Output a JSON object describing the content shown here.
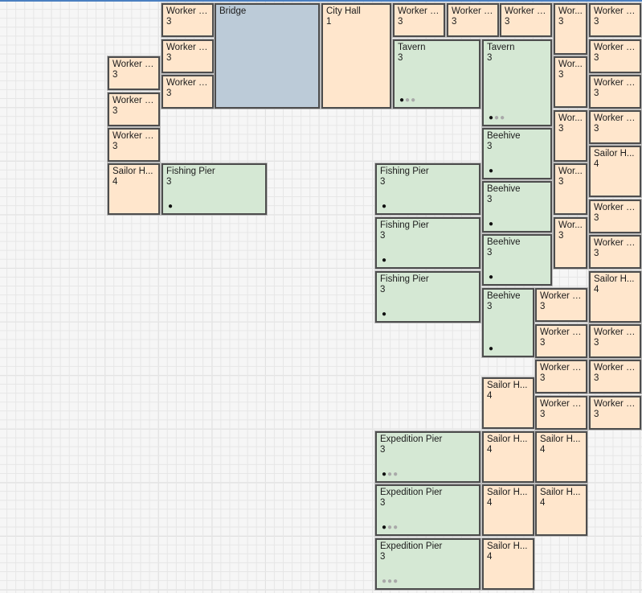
{
  "tiles": [
    {
      "name": "Worker H...",
      "level": "3",
      "kind": "worker"
    },
    {
      "name": "Bridge",
      "level": "",
      "kind": "road"
    },
    {
      "name": "City Hall",
      "level": "1",
      "kind": "civic"
    },
    {
      "name": "Worker H...",
      "level": "3",
      "kind": "worker"
    },
    {
      "name": "Worker H...",
      "level": "3",
      "kind": "worker"
    },
    {
      "name": "Worker H...",
      "level": "3",
      "kind": "worker"
    },
    {
      "name": "Wor...",
      "level": "3",
      "kind": "worker"
    },
    {
      "name": "Worker H...",
      "level": "3",
      "kind": "worker"
    },
    {
      "name": "Worker H...",
      "level": "3",
      "kind": "worker"
    },
    {
      "name": "Worker H...",
      "level": "3",
      "kind": "worker"
    },
    {
      "name": "Tavern",
      "level": "3",
      "kind": "prod",
      "dots": [
        1,
        0,
        0
      ]
    },
    {
      "name": "Tavern",
      "level": "3",
      "kind": "prod",
      "dots": [
        1,
        0,
        0
      ]
    },
    {
      "name": "Wor...",
      "level": "3",
      "kind": "worker"
    },
    {
      "name": "Worker H...",
      "level": "3",
      "kind": "worker"
    },
    {
      "name": "Worker H...",
      "level": "3",
      "kind": "worker"
    },
    {
      "name": "Worker H...",
      "level": "3",
      "kind": "worker"
    },
    {
      "name": "Worker H...",
      "level": "3",
      "kind": "worker"
    },
    {
      "name": "Wor...",
      "level": "3",
      "kind": "worker"
    },
    {
      "name": "Worker H...",
      "level": "3",
      "kind": "worker"
    },
    {
      "name": "Worker H...",
      "level": "3",
      "kind": "worker"
    },
    {
      "name": "Beehive",
      "level": "3",
      "kind": "prod",
      "dots": [
        1
      ]
    },
    {
      "name": "Sailor H...",
      "level": "4",
      "kind": "worker"
    },
    {
      "name": "Sailor H...",
      "level": "4",
      "kind": "worker"
    },
    {
      "name": "Fishing Pier",
      "level": "3",
      "kind": "prod",
      "dots": [
        1
      ]
    },
    {
      "name": "Fishing Pier",
      "level": "3",
      "kind": "prod",
      "dots": [
        1
      ]
    },
    {
      "name": "Wor...",
      "level": "3",
      "kind": "worker"
    },
    {
      "name": "Beehive",
      "level": "3",
      "kind": "prod",
      "dots": [
        1
      ]
    },
    {
      "name": "Worker H...",
      "level": "3",
      "kind": "worker"
    },
    {
      "name": "Fishing Pier",
      "level": "3",
      "kind": "prod",
      "dots": [
        1
      ]
    },
    {
      "name": "Wor...",
      "level": "3",
      "kind": "worker"
    },
    {
      "name": "Beehive",
      "level": "3",
      "kind": "prod",
      "dots": [
        1
      ]
    },
    {
      "name": "Worker H...",
      "level": "3",
      "kind": "worker"
    },
    {
      "name": "Fishing Pier",
      "level": "3",
      "kind": "prod",
      "dots": [
        1
      ]
    },
    {
      "name": "Sailor H...",
      "level": "4",
      "kind": "worker"
    },
    {
      "name": "Beehive",
      "level": "3",
      "kind": "prod",
      "dots": [
        1
      ]
    },
    {
      "name": "Worker H...",
      "level": "3",
      "kind": "worker"
    },
    {
      "name": "Worker H...",
      "level": "3",
      "kind": "worker"
    },
    {
      "name": "Worker H...",
      "level": "3",
      "kind": "worker"
    },
    {
      "name": "Worker H...",
      "level": "3",
      "kind": "worker"
    },
    {
      "name": "Worker H...",
      "level": "3",
      "kind": "worker"
    },
    {
      "name": "Sailor H...",
      "level": "4",
      "kind": "worker"
    },
    {
      "name": "Worker H...",
      "level": "3",
      "kind": "worker"
    },
    {
      "name": "Worker H...",
      "level": "3",
      "kind": "worker"
    },
    {
      "name": "Expedition Pier",
      "level": "3",
      "kind": "prod",
      "dots": [
        1,
        0,
        0
      ]
    },
    {
      "name": "Sailor H...",
      "level": "4",
      "kind": "worker"
    },
    {
      "name": "Sailor H...",
      "level": "4",
      "kind": "worker"
    },
    {
      "name": "Expedition Pier",
      "level": "3",
      "kind": "prod",
      "dots": [
        1,
        0,
        0
      ]
    },
    {
      "name": "Sailor H...",
      "level": "4",
      "kind": "worker"
    },
    {
      "name": "Sailor H...",
      "level": "4",
      "kind": "worker"
    },
    {
      "name": "Expedition Pier",
      "level": "3",
      "kind": "prod",
      "dots": [
        0,
        0,
        0
      ]
    },
    {
      "name": "Sailor H...",
      "level": "4",
      "kind": "worker"
    }
  ]
}
